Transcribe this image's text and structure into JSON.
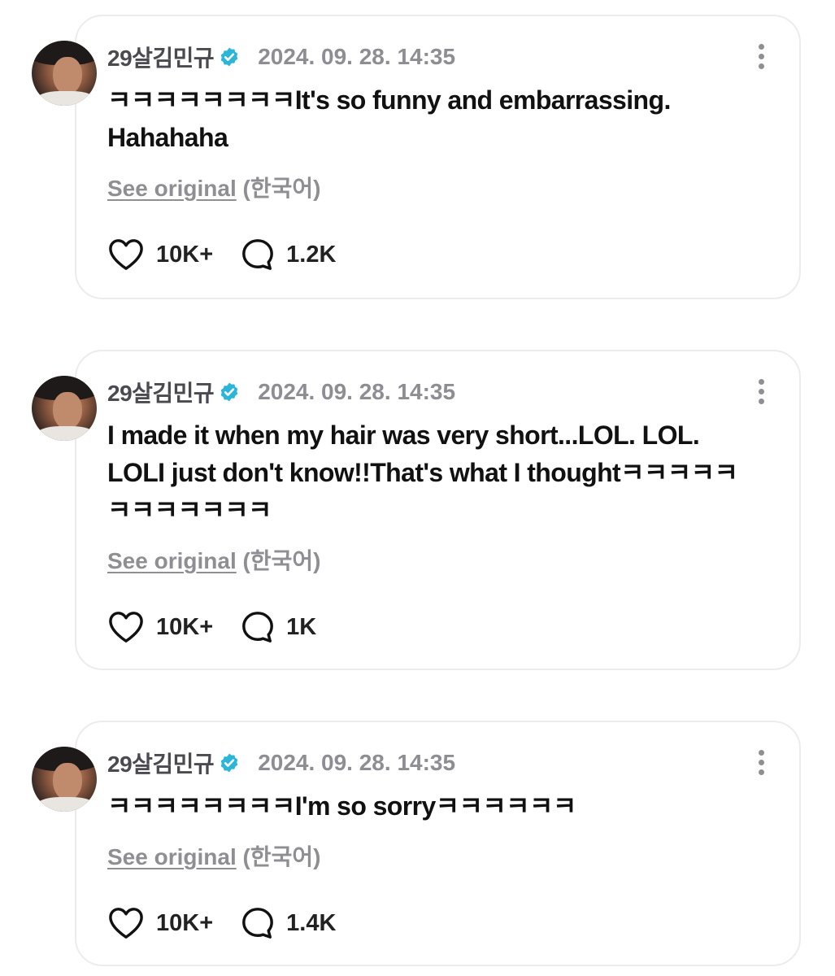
{
  "posts": [
    {
      "username": "29살김민규",
      "timestamp": "2024. 09. 28. 14:35",
      "text": "ㅋㅋㅋㅋㅋㅋㅋㅋIt's so funny and embarrassing. Hahahaha",
      "see_original": "See original",
      "original_language": "(한국어)",
      "likes": "10K+",
      "comments": "1.2K"
    },
    {
      "username": "29살김민규",
      "timestamp": "2024. 09. 28. 14:35",
      "text": "I made it when my hair was very short...LOL. LOL. LOLI just don't know!!That's what I thoughtㅋㅋㅋㅋㅋㅋㅋㅋㅋㅋㅋㅋ",
      "see_original": "See original",
      "original_language": "(한국어)",
      "likes": "10K+",
      "comments": "1K"
    },
    {
      "username": "29살김민규",
      "timestamp": "2024. 09. 28. 14:35",
      "text": "ㅋㅋㅋㅋㅋㅋㅋㅋI'm so sorryㅋㅋㅋㅋㅋㅋ",
      "see_original": "See original",
      "original_language": "(한국어)",
      "likes": "10K+",
      "comments": "1.4K"
    }
  ],
  "colors": {
    "verified_badge": "#2bb5d8",
    "username": "#4a4a50",
    "timestamp": "#8d8d93",
    "card_border": "#ececef"
  },
  "icons": {
    "verified": "verified-badge-icon",
    "more": "more-options-icon",
    "like": "heart-icon",
    "comment": "comment-bubble-icon"
  }
}
